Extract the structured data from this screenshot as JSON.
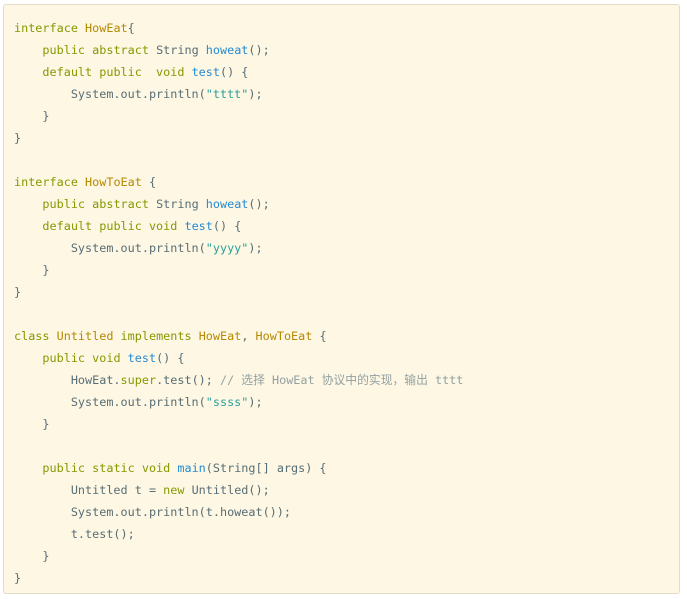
{
  "code_block": {
    "colors": {
      "background": "#fdf7e4",
      "keyword": "#859900",
      "class_name": "#b58900",
      "function": "#268bd2",
      "string": "#2aa198",
      "comment": "#93a1a1",
      "plain": "#586e75"
    },
    "lines": [
      [
        {
          "t": "kw",
          "v": "interface "
        },
        {
          "t": "cls",
          "v": "HowEat"
        },
        {
          "t": "plain",
          "v": "{"
        }
      ],
      [
        {
          "t": "plain",
          "v": "    "
        },
        {
          "t": "kw",
          "v": "public abstract "
        },
        {
          "t": "plain",
          "v": "String "
        },
        {
          "t": "fn",
          "v": "howeat"
        },
        {
          "t": "plain",
          "v": "();"
        }
      ],
      [
        {
          "t": "plain",
          "v": "    "
        },
        {
          "t": "kw",
          "v": "default public  void "
        },
        {
          "t": "fn",
          "v": "test"
        },
        {
          "t": "plain",
          "v": "() {"
        }
      ],
      [
        {
          "t": "plain",
          "v": "        System.out.println("
        },
        {
          "t": "str",
          "v": "\"tttt\""
        },
        {
          "t": "plain",
          "v": ");"
        }
      ],
      [
        {
          "t": "plain",
          "v": "    }"
        }
      ],
      [
        {
          "t": "plain",
          "v": "}"
        }
      ],
      [
        {
          "t": "plain",
          "v": ""
        }
      ],
      [
        {
          "t": "kw",
          "v": "interface "
        },
        {
          "t": "cls",
          "v": "HowToEat"
        },
        {
          "t": "plain",
          "v": " {"
        }
      ],
      [
        {
          "t": "plain",
          "v": "    "
        },
        {
          "t": "kw",
          "v": "public abstract "
        },
        {
          "t": "plain",
          "v": "String "
        },
        {
          "t": "fn",
          "v": "howeat"
        },
        {
          "t": "plain",
          "v": "();"
        }
      ],
      [
        {
          "t": "plain",
          "v": "    "
        },
        {
          "t": "kw",
          "v": "default public void "
        },
        {
          "t": "fn",
          "v": "test"
        },
        {
          "t": "plain",
          "v": "() {"
        }
      ],
      [
        {
          "t": "plain",
          "v": "        System.out.println("
        },
        {
          "t": "str",
          "v": "\"yyyy\""
        },
        {
          "t": "plain",
          "v": ");"
        }
      ],
      [
        {
          "t": "plain",
          "v": "    }"
        }
      ],
      [
        {
          "t": "plain",
          "v": "}"
        }
      ],
      [
        {
          "t": "plain",
          "v": ""
        }
      ],
      [
        {
          "t": "kw",
          "v": "class "
        },
        {
          "t": "cls",
          "v": "Untitled"
        },
        {
          "t": "kw",
          "v": " implements "
        },
        {
          "t": "cls",
          "v": "HowEat"
        },
        {
          "t": "plain",
          "v": ", "
        },
        {
          "t": "cls",
          "v": "HowToEat"
        },
        {
          "t": "plain",
          "v": " {"
        }
      ],
      [
        {
          "t": "plain",
          "v": "    "
        },
        {
          "t": "kw",
          "v": "public void "
        },
        {
          "t": "fn",
          "v": "test"
        },
        {
          "t": "plain",
          "v": "() {"
        }
      ],
      [
        {
          "t": "plain",
          "v": "        HowEat."
        },
        {
          "t": "kw",
          "v": "super"
        },
        {
          "t": "plain",
          "v": ".test(); "
        },
        {
          "t": "cmt",
          "v": "// 选择 HowEat 协议中的实现，输出 tttt"
        }
      ],
      [
        {
          "t": "plain",
          "v": "        System.out.println("
        },
        {
          "t": "str",
          "v": "\"ssss\""
        },
        {
          "t": "plain",
          "v": ");"
        }
      ],
      [
        {
          "t": "plain",
          "v": "    }"
        }
      ],
      [
        {
          "t": "plain",
          "v": ""
        }
      ],
      [
        {
          "t": "plain",
          "v": "    "
        },
        {
          "t": "kw",
          "v": "public static void "
        },
        {
          "t": "fn",
          "v": "main"
        },
        {
          "t": "plain",
          "v": "(String[] args) {"
        }
      ],
      [
        {
          "t": "plain",
          "v": "        Untitled t = "
        },
        {
          "t": "kw",
          "v": "new "
        },
        {
          "t": "plain",
          "v": "Untitled();"
        }
      ],
      [
        {
          "t": "plain",
          "v": "        System.out.println(t.howeat());"
        }
      ],
      [
        {
          "t": "plain",
          "v": "        t.test();"
        }
      ],
      [
        {
          "t": "plain",
          "v": "    }"
        }
      ],
      [
        {
          "t": "plain",
          "v": "}"
        }
      ]
    ]
  }
}
